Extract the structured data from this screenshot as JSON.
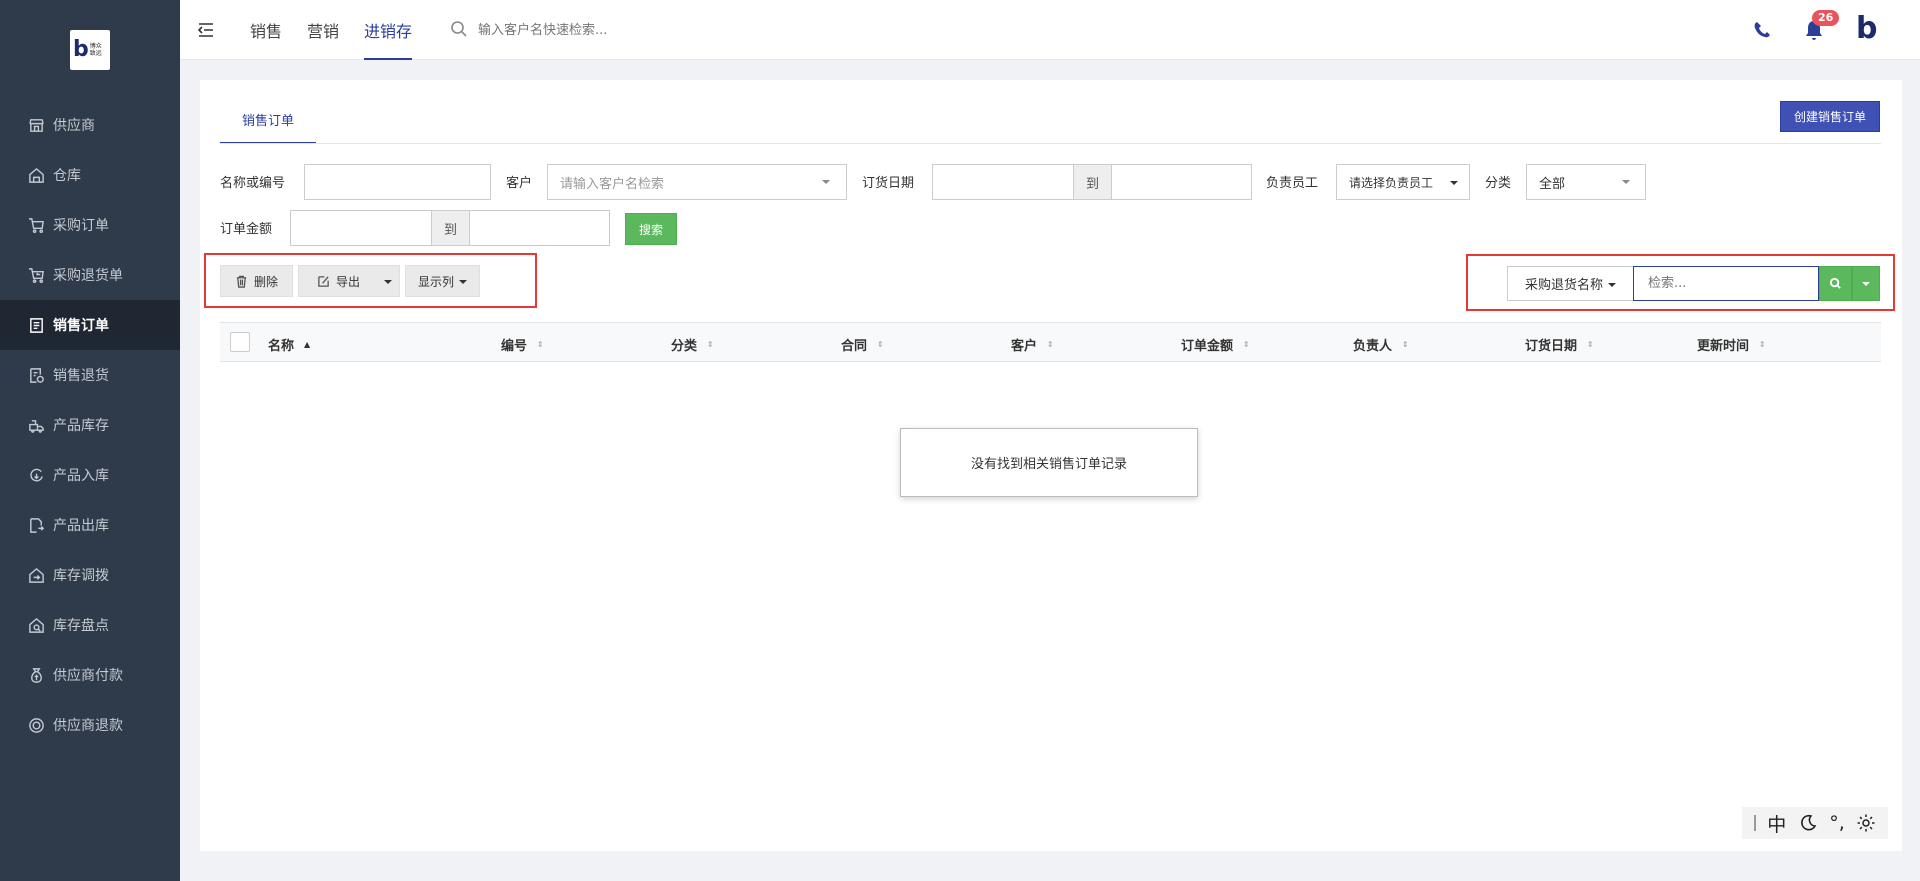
{
  "app": {
    "logo_text": "博众致远",
    "logo_letter": "b"
  },
  "sidebar": {
    "items": [
      {
        "label": "供应商",
        "icon": "store-icon"
      },
      {
        "label": "仓库",
        "icon": "warehouse-icon"
      },
      {
        "label": "采购订单",
        "icon": "cart-icon"
      },
      {
        "label": "采购退货单",
        "icon": "cart-return-icon"
      },
      {
        "label": "销售订单",
        "icon": "order-list-icon",
        "active": true
      },
      {
        "label": "销售退货",
        "icon": "document-return-icon"
      },
      {
        "label": "产品库存",
        "icon": "inventory-icon"
      },
      {
        "label": "产品入库",
        "icon": "stock-in-icon"
      },
      {
        "label": "产品出库",
        "icon": "stock-out-icon"
      },
      {
        "label": "库存调拨",
        "icon": "transfer-icon"
      },
      {
        "label": "库存盘点",
        "icon": "stocktake-icon"
      },
      {
        "label": "供应商付款",
        "icon": "money-bag-icon"
      },
      {
        "label": "供应商退款",
        "icon": "refund-icon"
      }
    ]
  },
  "topbar": {
    "tabs": [
      {
        "label": "销售"
      },
      {
        "label": "营销"
      },
      {
        "label": "进销存",
        "active": true
      }
    ],
    "search_placeholder": "输入客户名快速检索...",
    "notification_count": "26"
  },
  "main": {
    "tab_label": "销售订单",
    "create_button": "创建销售订单",
    "filters": {
      "name_label": "名称或编号",
      "customer_label": "客户",
      "customer_placeholder": "请输入客户名检索",
      "date_label": "订货日期",
      "to_label": "到",
      "staff_label": "负责员工",
      "staff_value": "请选择负责员工",
      "category_label": "分类",
      "category_value": "全部",
      "amount_label": "订单金额",
      "search_button": "搜索"
    },
    "toolbar": {
      "delete": "删除",
      "export": "导出",
      "columns": "显示列"
    },
    "table_search": {
      "field_label": "采购退货名称",
      "placeholder": "检索..."
    },
    "table": {
      "columns": [
        "名称",
        "编号",
        "分类",
        "合同",
        "客户",
        "订单金额",
        "负责人",
        "订货日期",
        "更新时间"
      ],
      "empty_message": "没有找到相关销售订单记录"
    }
  },
  "ime": {
    "mode": "中",
    "punct": "°,"
  },
  "colors": {
    "sidebar_bg": "#2f3a4a",
    "accent": "#3f51b5",
    "success": "#5cb85c",
    "highlight_box": "#e53935",
    "badge": "#e9545c"
  }
}
